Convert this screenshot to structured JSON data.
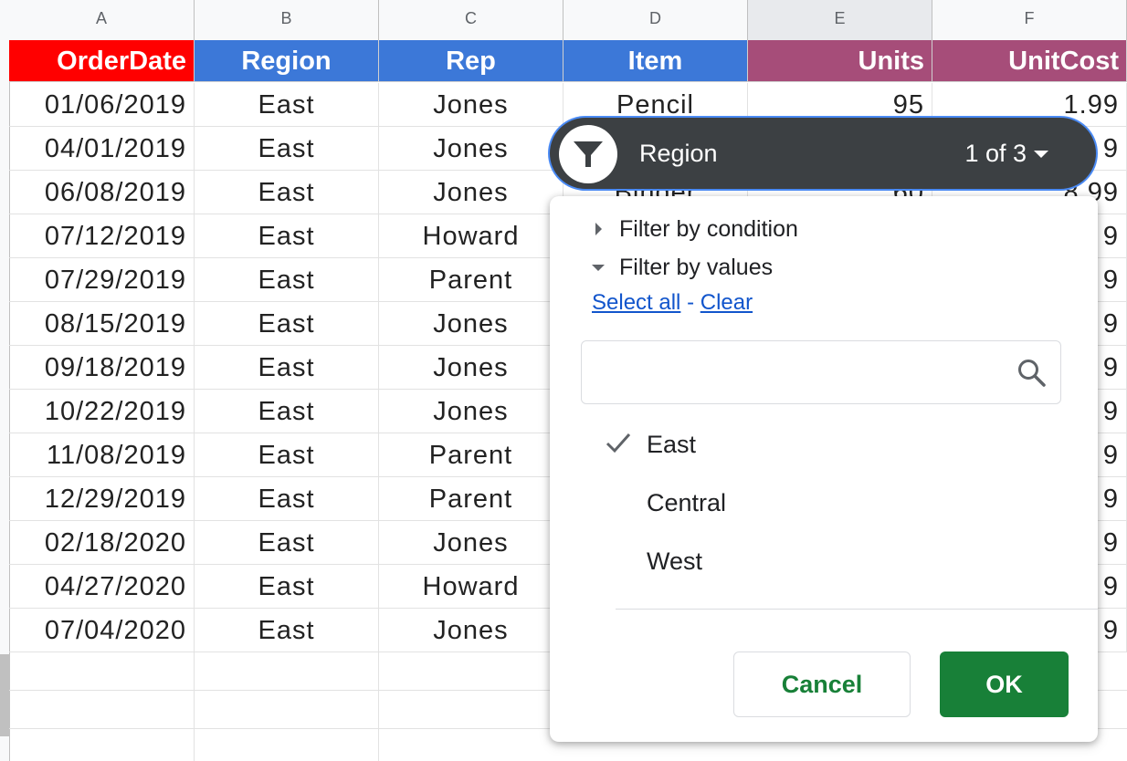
{
  "columns": [
    "A",
    "B",
    "C",
    "D",
    "E",
    "F"
  ],
  "headers": {
    "order_date": "OrderDate",
    "region": "Region",
    "rep": "Rep",
    "item": "Item",
    "units": "Units",
    "unit_cost": "UnitCost"
  },
  "rows": [
    {
      "date": "01/06/2019",
      "region": "East",
      "rep": "Jones",
      "item": "Pencil",
      "units": "95",
      "cost": "1.99"
    },
    {
      "date": "04/01/2019",
      "region": "East",
      "rep": "Jones",
      "cost_tail": "9"
    },
    {
      "date": "06/08/2019",
      "region": "East",
      "rep": "Jones",
      "item_partial": "Binder",
      "units_partial": "60",
      "cost_partial": "8.99"
    },
    {
      "date": "07/12/2019",
      "region": "East",
      "rep": "Howard",
      "cost_tail": "9"
    },
    {
      "date": "07/29/2019",
      "region": "East",
      "rep": "Parent",
      "cost_tail": "9"
    },
    {
      "date": "08/15/2019",
      "region": "East",
      "rep": "Jones",
      "cost_tail": "9"
    },
    {
      "date": "09/18/2019",
      "region": "East",
      "rep": "Jones",
      "cost_tail": "9"
    },
    {
      "date": "10/22/2019",
      "region": "East",
      "rep": "Jones",
      "cost_tail": "9"
    },
    {
      "date": "11/08/2019",
      "region": "East",
      "rep": "Parent",
      "cost_tail": "9"
    },
    {
      "date": "12/29/2019",
      "region": "East",
      "rep": "Parent",
      "cost_tail": "9"
    },
    {
      "date": "02/18/2020",
      "region": "East",
      "rep": "Jones",
      "cost_tail": "9"
    },
    {
      "date": "04/27/2020",
      "region": "East",
      "rep": "Howard",
      "cost_tail": "9"
    },
    {
      "date": "07/04/2020",
      "region": "East",
      "rep": "Jones",
      "cost_tail": "9"
    }
  ],
  "filter_chip": {
    "icon": "filter-icon",
    "label": "Region",
    "count": "1 of 3"
  },
  "filter_panel": {
    "by_condition": "Filter by condition",
    "by_values": "Filter by values",
    "select_all": "Select all",
    "separator": "-",
    "clear": "Clear",
    "search_placeholder": "",
    "values": [
      {
        "label": "East",
        "checked": true
      },
      {
        "label": "Central",
        "checked": false
      },
      {
        "label": "West",
        "checked": false
      }
    ],
    "cancel": "Cancel",
    "ok": "OK"
  },
  "colors": {
    "orderdate_header": "#ff0000",
    "blue_header": "#3c78d8",
    "purple_header": "#a64d79",
    "chip_bg": "#3c4043",
    "chip_border": "#4a8af4",
    "ok_button": "#188038",
    "link": "#1155cc"
  }
}
